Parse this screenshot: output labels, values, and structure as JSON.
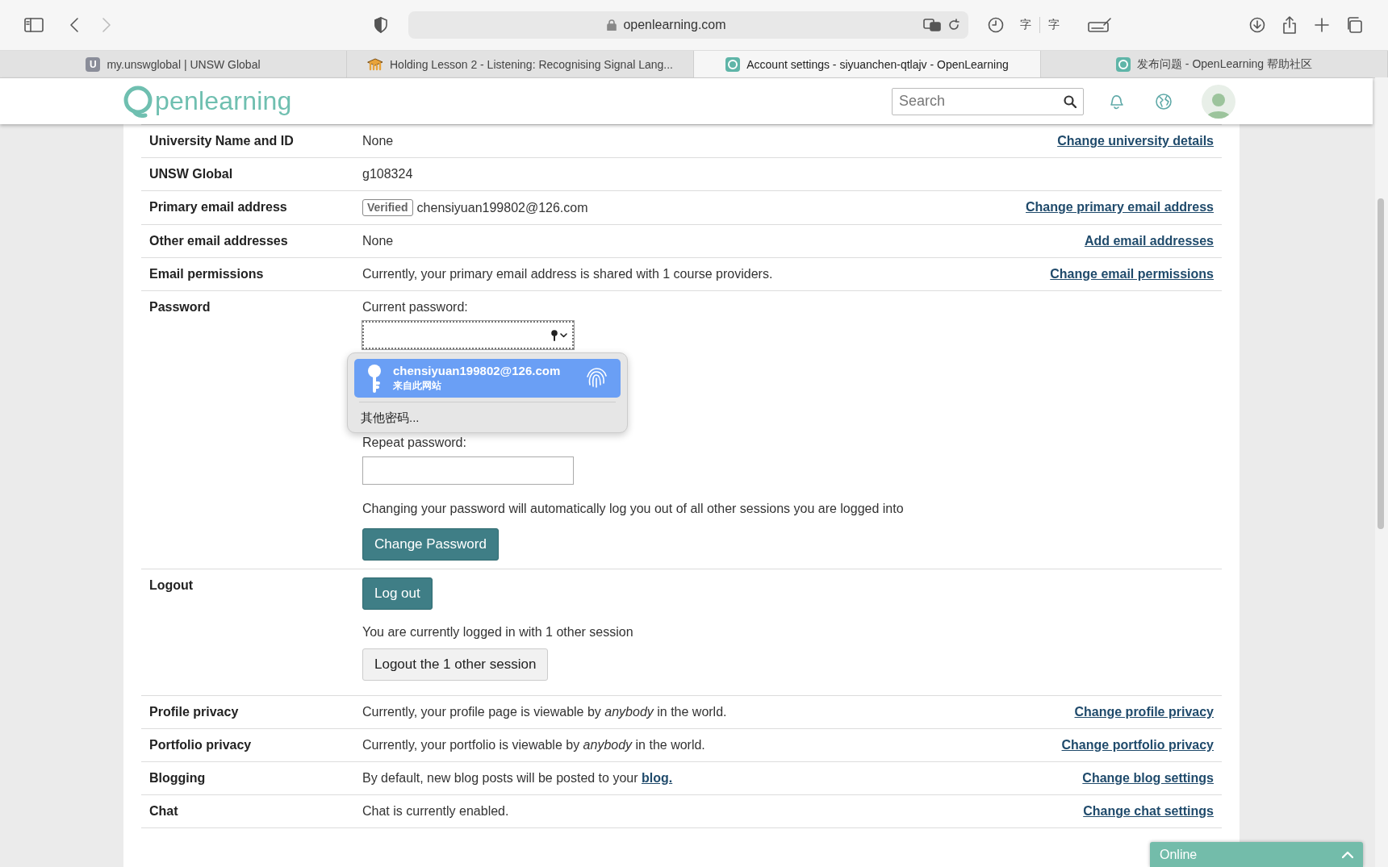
{
  "browser": {
    "address": "openlearning.com",
    "nav": {
      "back_disabled": false,
      "forward_disabled": true
    },
    "translate_glyphs": [
      "字",
      "字"
    ],
    "tabs": [
      {
        "title": "my.unswglobal | UNSW Global",
        "kind": "letter",
        "icon_text": "U",
        "selected": false
      },
      {
        "title": "Holding Lesson 2 - Listening: Recognising Signal Lang...",
        "kind": "cap",
        "selected": false
      },
      {
        "title": "Account settings - siyuanchen-qtlajv - OpenLearning",
        "kind": "ring",
        "selected": true
      },
      {
        "title": "发布问题 - OpenLearning 帮助社区",
        "kind": "ring",
        "selected": false
      }
    ]
  },
  "header": {
    "logo_text": "penlearning",
    "search": {
      "placeholder": "Search"
    }
  },
  "settings": {
    "rows": [
      {
        "kind": "text",
        "label": "University Name and ID",
        "value": "None",
        "action": "Change university details"
      },
      {
        "kind": "text",
        "label": "UNSW Global",
        "value": "g108324"
      },
      {
        "kind": "verified_email",
        "label": "Primary email address",
        "badge": "Verified",
        "value": "chensiyuan199802@126.com",
        "action": "Change primary email address"
      },
      {
        "kind": "text",
        "label": "Other email addresses",
        "value": "None",
        "action": "Add email addresses"
      },
      {
        "kind": "text",
        "label": "Email permissions",
        "value": "Currently, your primary email address is shared with 1 course providers.",
        "action": "Change email permissions"
      },
      {
        "kind": "password",
        "label": "Password",
        "current_label": "Current password:",
        "repeat_label": "Repeat password:",
        "note": "Changing your password will automatically log you out of all other sessions you are logged into",
        "button": "Change Password",
        "autofill": {
          "account": "chensiyuan199802@126.com",
          "source": "来自此网站",
          "selected": true,
          "other": "其他密码..."
        }
      },
      {
        "kind": "logout",
        "label": "Logout",
        "button": "Log out",
        "sessions_note": "You are currently logged in with 1 other session",
        "sessions_button": "Logout the 1 other session"
      },
      {
        "kind": "text",
        "label": "Profile privacy",
        "value": "Currently, your profile page is viewable by *anybody* in the world.",
        "action": "Change profile privacy"
      },
      {
        "kind": "text",
        "label": "Portfolio privacy",
        "value": "Currently, your portfolio is viewable by *anybody* in the world.",
        "action": "Change portfolio privacy"
      },
      {
        "kind": "link_text",
        "label": "Blogging",
        "value": "By default, new blog posts will be posted to your",
        "link": "blog.",
        "action": "Change blog settings"
      },
      {
        "kind": "text",
        "label": "Chat",
        "value": "Chat is currently enabled.",
        "action": "Change chat settings"
      }
    ]
  },
  "chat_bar": {
    "label": "Online"
  }
}
